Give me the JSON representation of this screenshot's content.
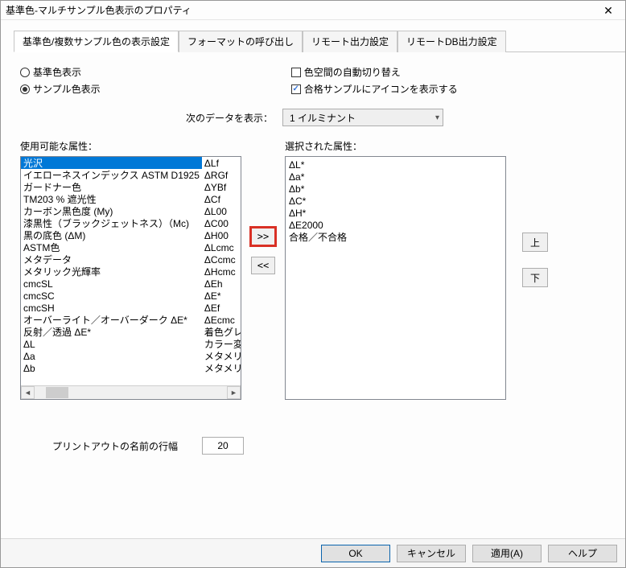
{
  "window": {
    "title": "基準色-マルチサンプル色表示のプロパティ"
  },
  "tabs": {
    "main": "基準色/複数サンプル色の表示設定",
    "format": "フォーマットの呼び出し",
    "remote": "リモート出力設定",
    "remotedb": "リモートDB出力設定"
  },
  "radios": {
    "reference": "基準色表示",
    "sample": "サンプル色表示"
  },
  "checks": {
    "auto_switch": "色空間の自動切り替え",
    "show_icon": "合格サンプルにアイコンを表示する"
  },
  "data_label": "次のデータを表示：",
  "data_option": "1 イルミナント",
  "available_label": "使用可能な属性：",
  "selected_label": "選択された属性：",
  "available_left": [
    "光沢",
    "イエローネスインデックス ASTM D1925",
    "ガードナー色",
    "TM203 % 遮光性",
    "カーボン黒色度 (My)",
    "漆黒性（ブラックジェットネス）（Mc)",
    "黒の底色 (ΔM)",
    "ASTM色",
    "メタデータ",
    "メタリック光輝率",
    "cmcSL",
    "cmcSC",
    "cmcSH",
    "オーバーライト／オーバーダーク ΔE*",
    "反射／透過 ΔE*",
    "ΔL",
    "Δa",
    "Δb"
  ],
  "available_right": [
    "ΔLf",
    "ΔRGf",
    "ΔYBf",
    "ΔCf",
    "ΔL00",
    "ΔC00",
    "ΔH00",
    "ΔLcmc",
    "ΔCcmc",
    "ΔHcmc",
    "ΔEh",
    "ΔE*",
    "ΔEf",
    "ΔEcmc",
    "着色グレースケ",
    "カラー変化のグ",
    "メタメリズムイン",
    "メタメリズムイン"
  ],
  "selected": [
    "ΔL*",
    "Δa*",
    "Δb*",
    "ΔC*",
    "ΔH*",
    "ΔE2000",
    "合格／不合格"
  ],
  "transfer": {
    "add": ">>",
    "remove": "<<"
  },
  "order": {
    "up": "上",
    "down": "下"
  },
  "print_label": "プリントアウトの名前の行幅",
  "print_value": "20",
  "buttons": {
    "ok": "OK",
    "cancel": "キャンセル",
    "apply": "適用(A)",
    "help": "ヘルプ"
  }
}
